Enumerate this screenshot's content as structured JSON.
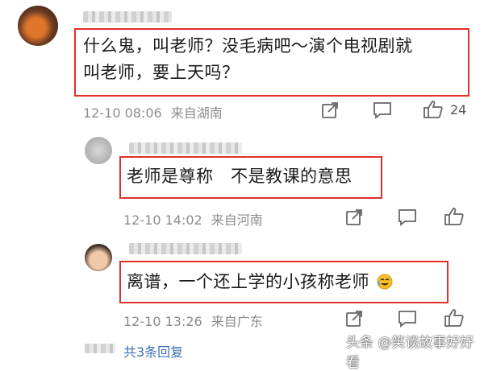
{
  "comments": [
    {
      "text_line1": "什么鬼，叫老师？没毛病吧～演个电视剧就",
      "text_line2": "叫老师，要上天吗？",
      "timestamp": "12-10 08:06",
      "location": "来自湖南",
      "like_count": "24"
    },
    {
      "text_line1": "老师是尊称　不是教课的意思",
      "timestamp": "12-10 14:02",
      "location": "来自河南"
    },
    {
      "text_line1": "离谱，一个还上学的小孩称老师",
      "timestamp": "12-10 13:26",
      "location": "来自广东"
    }
  ],
  "footer": {
    "replies_label": "共3条回复"
  },
  "watermark": {
    "text": "头条 @笑谈故事好好看"
  },
  "colors": {
    "highlight_border": "#e0302b",
    "meta_text": "#8c8c8c",
    "link": "#3d6fb6"
  },
  "icons": [
    "share-icon",
    "comment-icon",
    "like-icon",
    "emoji-icon"
  ]
}
